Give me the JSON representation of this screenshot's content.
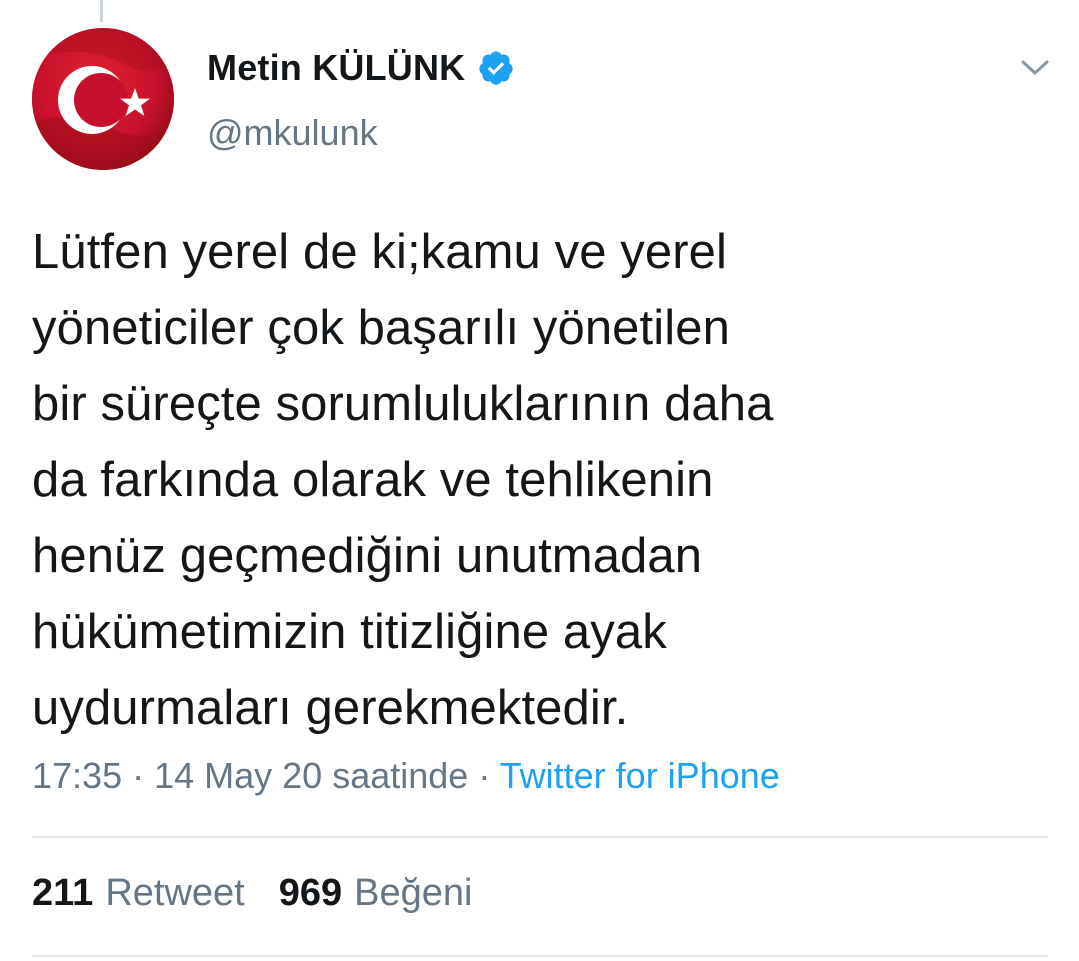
{
  "tweet": {
    "author": {
      "display_name": "Metin KÜLÜNK",
      "handle": "@mkulunk",
      "verified": true,
      "avatar_icon": "turkish-flag-avatar"
    },
    "text": "Lütfen yerel de ki;kamu ve yerel\nyöneticiler çok başarılı yönetilen\nbir süreçte sorumluluklarının daha\nda farkında olarak ve tehlikenin\nhenüz geçmediğini unutmadan\nhükümetimizin titizliğine ayak\nuydurmaları gerekmektedir.",
    "meta": {
      "time": "17:35",
      "separator": " · ",
      "date": "14 May 20 saatinde",
      "source": "Twitter for iPhone"
    },
    "stats": {
      "retweets": "211",
      "retweets_label": "Retweet",
      "likes": "969",
      "likes_label": "Beğeni"
    }
  },
  "colors": {
    "text": "#14171a",
    "secondary": "#657786",
    "link": "#1da1f2",
    "verified": "#1da1f2",
    "divider": "#e1e8ed",
    "flag_red": "#c8102e"
  }
}
